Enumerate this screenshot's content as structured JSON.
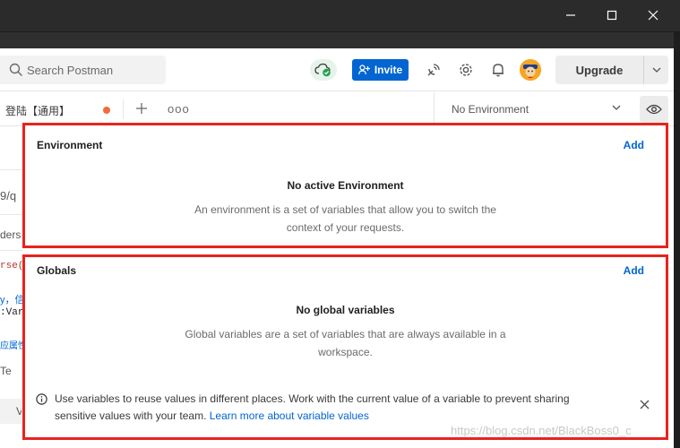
{
  "header": {
    "search_placeholder": "Search Postman",
    "invite_label": "Invite",
    "upgrade_label": "Upgrade"
  },
  "tabs": {
    "active_tab_label": "登陆【通用】",
    "more_label": "ooo"
  },
  "environment_selector": {
    "selected": "No Environment"
  },
  "left_fragments": [
    "9/q",
    "ders",
    "rse(",
    "y，信",
    ":Var:",
    "应属性",
    "Te",
    "V"
  ],
  "environment_section": {
    "title": "Environment",
    "add_label": "Add",
    "heading": "No active Environment",
    "description_line1": "An environment is a set of variables that allow you to switch the",
    "description_line2": "context of your requests."
  },
  "globals_section": {
    "title": "Globals",
    "add_label": "Add",
    "heading": "No global variables",
    "description_line1": "Global variables are a set of variables that are always available in a",
    "description_line2": "workspace."
  },
  "info_banner": {
    "text_line1": "Use variables to reuse values in different places. Work with the current value of a variable to prevent sharing",
    "text_line2": "sensitive values with your team. ",
    "link_label": "Learn more about variable values"
  },
  "watermark": "https://blog.csdn.net/BlackBoss0_c",
  "colors": {
    "accent": "#0265d2",
    "highlight_border": "#e8231e",
    "sync_ok": "#1fa24a",
    "unsaved_dot": "#f26b3a"
  },
  "icons": {
    "window": [
      "minimize-icon",
      "maximize-icon",
      "close-icon"
    ],
    "header": [
      "search-icon",
      "cloud-sync-icon",
      "add-user-icon",
      "satellite-icon",
      "gear-icon",
      "bell-icon",
      "avatar",
      "chevron-down-icon"
    ],
    "tabbar": [
      "plus-icon",
      "more-icon",
      "chevron-down-icon",
      "eye-icon"
    ],
    "banner": [
      "info-icon",
      "close-icon"
    ]
  }
}
